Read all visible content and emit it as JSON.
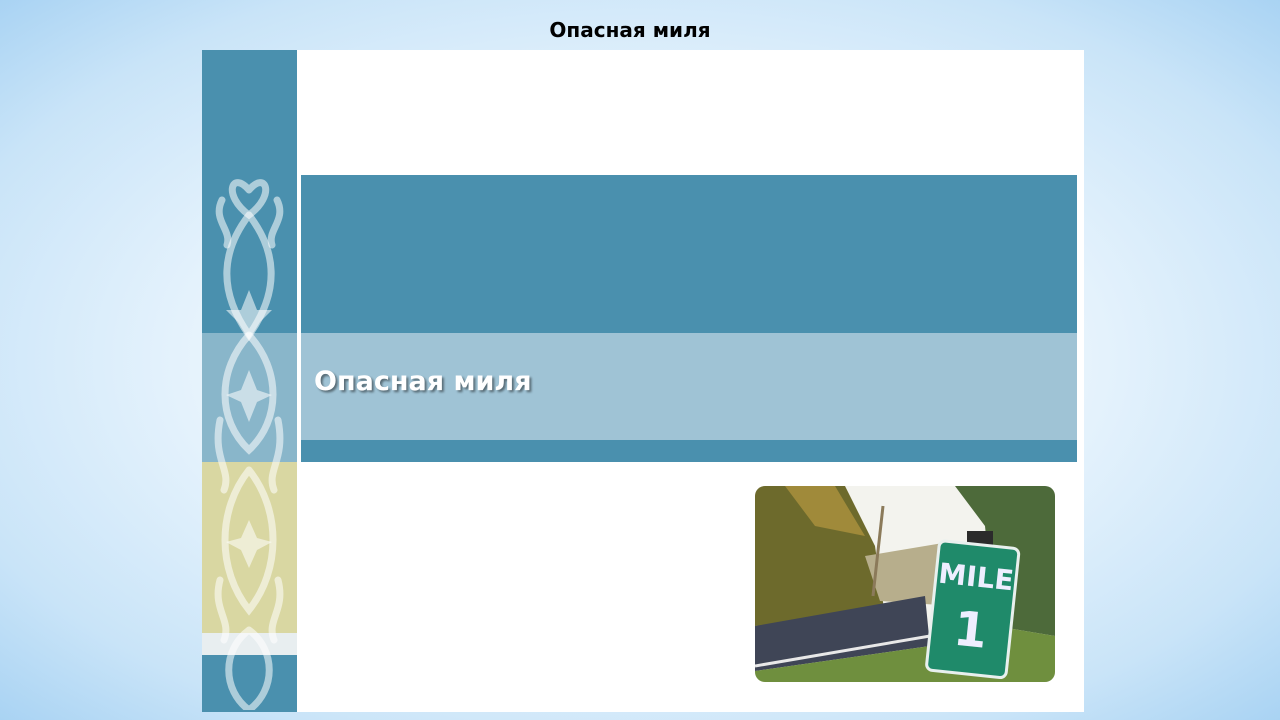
{
  "header": {
    "title": "Опасная миля"
  },
  "slide": {
    "title": "Опасная миля",
    "photo": {
      "sign_line1": "MILE",
      "sign_line2": "1"
    },
    "colors": {
      "accent": "#4a90ae",
      "accent_light": "#9fc3d5",
      "ornament_yellow": "#d9d7a2"
    },
    "ornament": "kazakh-ornament"
  }
}
